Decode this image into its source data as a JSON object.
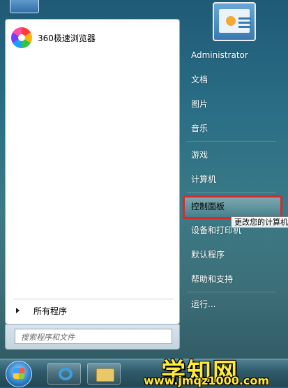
{
  "start_menu": {
    "pinned": [
      {
        "label": "360极速浏览器",
        "icon": "360-browser-icon"
      }
    ],
    "all_programs_label": "所有程序",
    "search_placeholder": "搜索程序和文件",
    "right_items": [
      "Administrator",
      "文档",
      "图片",
      "音乐",
      "游戏",
      "计算机",
      "控制面板",
      "设备和打印机",
      "默认程序",
      "帮助和支持",
      "运行..."
    ],
    "highlighted_item": "控制面板",
    "highlight_color": "#d62b2b",
    "tooltip": "更改您的计算机"
  },
  "taskbar": {
    "items": [
      "start-orb",
      "ie-icon",
      "explorer-icon"
    ]
  },
  "watermark": {
    "main": "学知网",
    "url": "www.jmqz1000.com"
  }
}
